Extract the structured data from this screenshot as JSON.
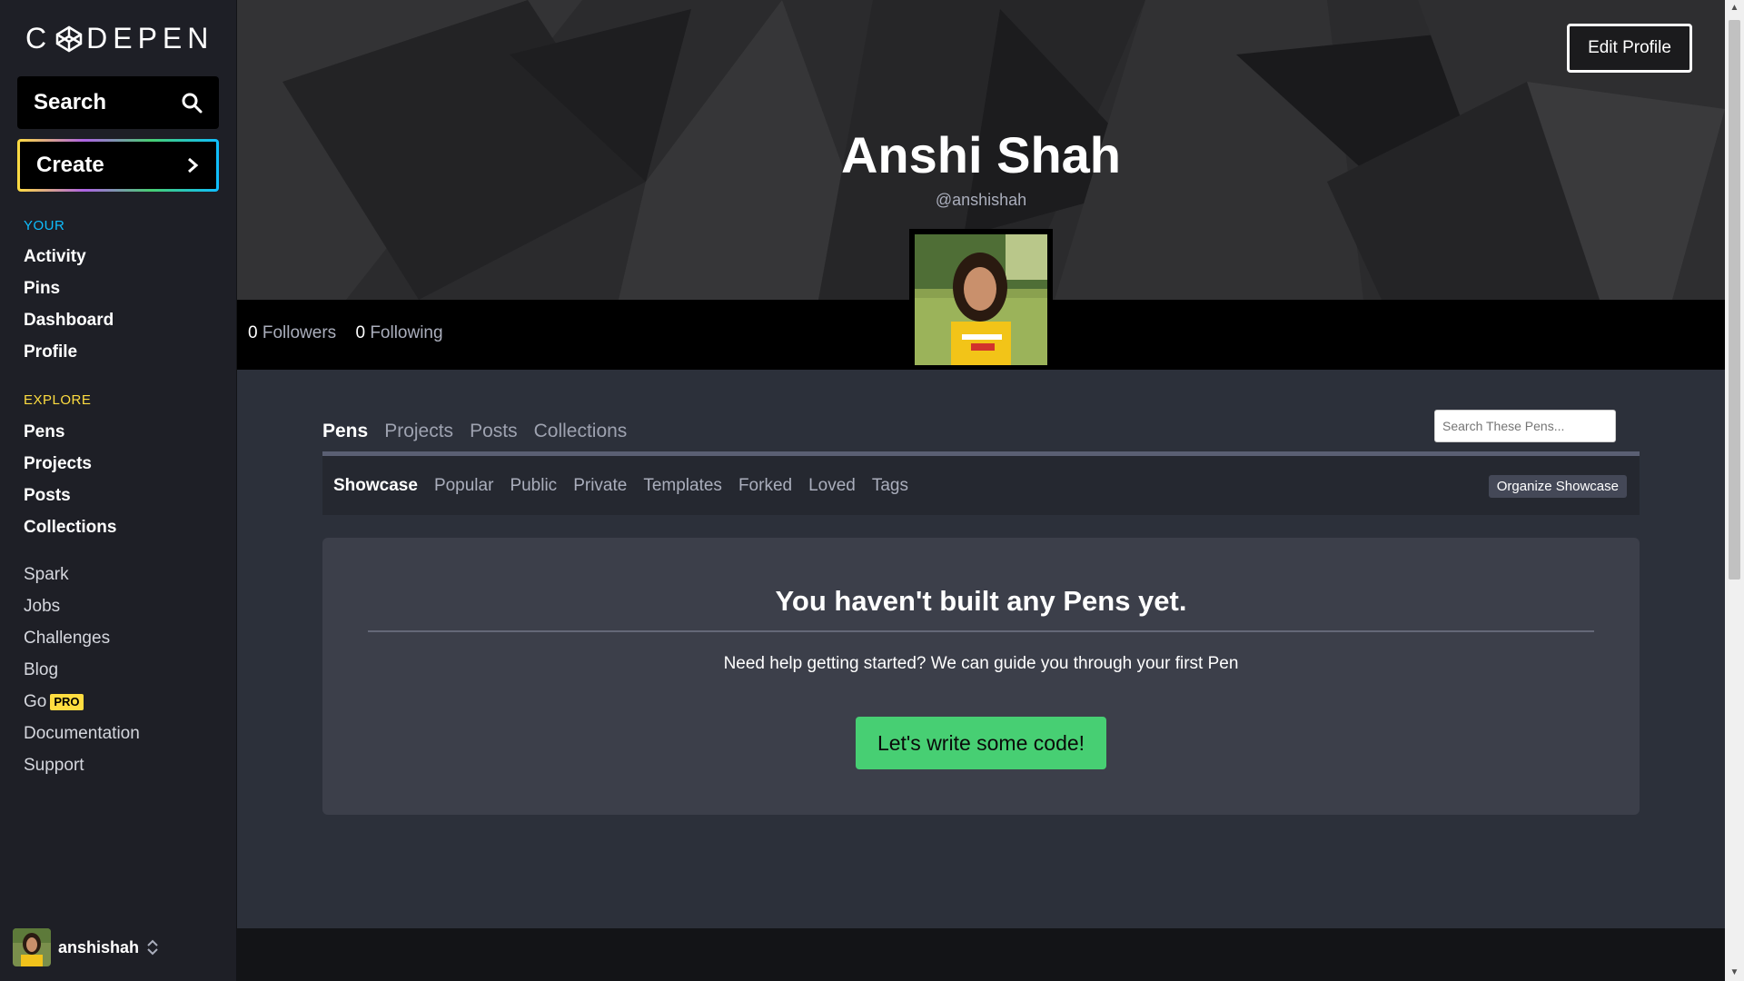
{
  "sidebar": {
    "logo_text": "C DEPEN",
    "search_label": "Search",
    "create_label": "Create",
    "your_section": {
      "label": "YOUR",
      "color": "#0ebeff",
      "items": [
        "Activity",
        "Pins",
        "Dashboard",
        "Profile"
      ]
    },
    "explore_section": {
      "label": "EXPLORE",
      "color": "#ffdd40",
      "items": [
        "Pens",
        "Projects",
        "Posts",
        "Collections"
      ]
    },
    "misc_items": [
      "Spark",
      "Jobs",
      "Challenges",
      "Blog",
      "Go",
      "Documentation",
      "Support"
    ],
    "pro_badge": "PRO",
    "username": "anshishah"
  },
  "header": {
    "edit_profile_label": "Edit Profile",
    "name": "Anshi Shah",
    "handle": "@anshishah",
    "followers_count": "0",
    "followers_label": "Followers",
    "following_count": "0",
    "following_label": "Following"
  },
  "main": {
    "tabs": [
      "Pens",
      "Projects",
      "Posts",
      "Collections"
    ],
    "active_tab": "Pens",
    "search_placeholder": "Search These Pens...",
    "subtabs": [
      "Showcase",
      "Popular",
      "Public",
      "Private",
      "Templates",
      "Forked",
      "Loved",
      "Tags"
    ],
    "active_subtab": "Showcase",
    "organize_label": "Organize Showcase",
    "empty_title": "You haven't built any Pens yet.",
    "empty_text": "Need help getting started? We can guide you through your first Pen",
    "cta_label": "Let's write some code!"
  },
  "colors": {
    "cta_green": "#47cf73",
    "sidebar_bg": "#1e1f26",
    "main_bg": "#2c303a",
    "pro_yellow": "#ffdd40"
  }
}
